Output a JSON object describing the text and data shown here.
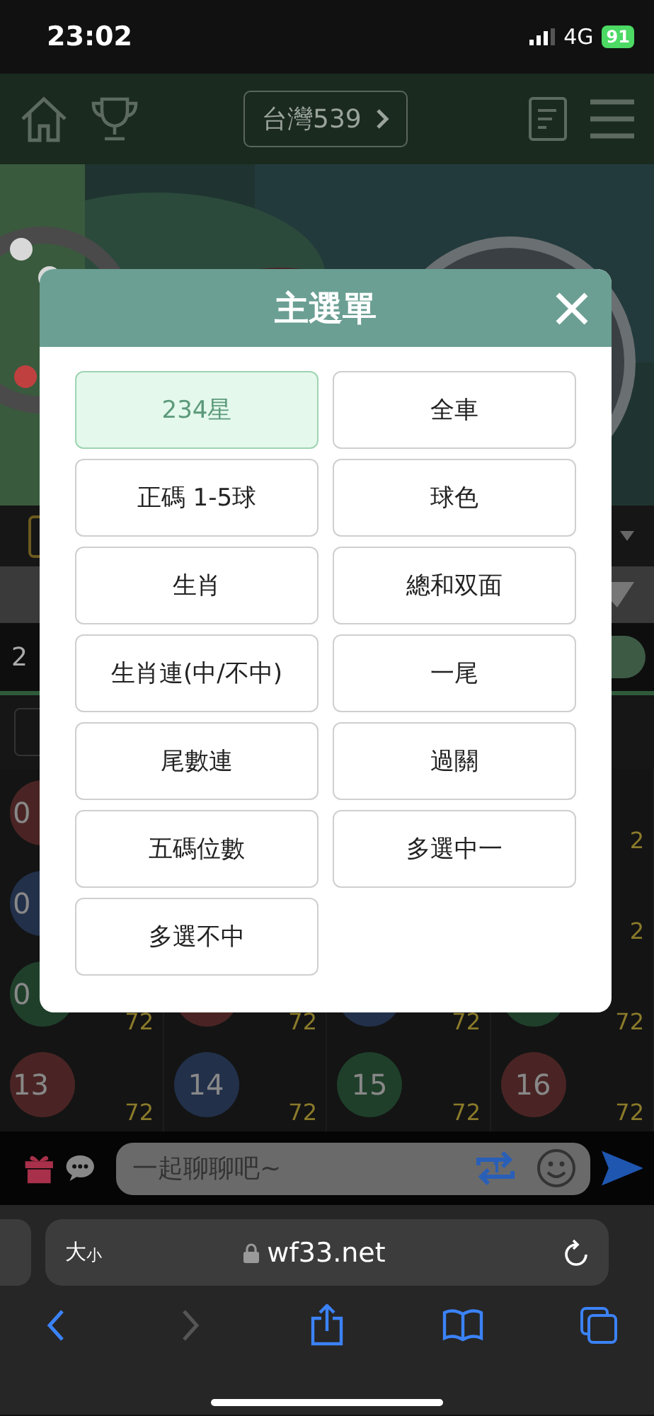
{
  "status_bar": {
    "time": "23:02",
    "network": "4G",
    "battery": "91"
  },
  "header": {
    "lottery_button": "台灣539"
  },
  "tab_row": {
    "label": "2"
  },
  "ball_grid": [
    [
      {
        "ball": "0",
        "color": "#4a2424"
      },
      {
        "odds": "2"
      }
    ],
    [
      {
        "ball": "0",
        "color": "#22304a"
      },
      {
        "odds": "2"
      }
    ],
    [
      {
        "ball": "0",
        "color": "#1f3f2a",
        "odds": "72"
      },
      {
        "color": "#4a2424",
        "odds": "72"
      },
      {
        "color": "#22304a",
        "odds": "72"
      },
      {
        "color": "#1f3f2a",
        "odds": "72"
      }
    ],
    [
      {
        "ball": "13",
        "color": "#4a2424",
        "odds": "72"
      },
      {
        "ball": "14",
        "color": "#22304a",
        "odds": "72"
      },
      {
        "ball": "15",
        "color": "#1f3f2a",
        "odds": "72"
      },
      {
        "ball": "16",
        "color": "#4a2424",
        "odds": "72"
      }
    ]
  ],
  "chat_bar": {
    "placeholder": "一起聊聊吧~"
  },
  "browser": {
    "text_size_button": "大小",
    "address": "wf33.net",
    "forward_disabled": true
  },
  "main_menu": {
    "title": "主選單",
    "items": [
      {
        "label": "234星",
        "selected": true
      },
      {
        "label": "全車",
        "selected": false
      },
      {
        "label": "正碼 1-5球",
        "selected": false
      },
      {
        "label": "球色",
        "selected": false
      },
      {
        "label": "生肖",
        "selected": false
      },
      {
        "label": "總和双面",
        "selected": false
      },
      {
        "label": "生肖連(中/不中)",
        "selected": false
      },
      {
        "label": "一尾",
        "selected": false
      },
      {
        "label": "尾數連",
        "selected": false
      },
      {
        "label": "過關",
        "selected": false
      },
      {
        "label": "五碼位數",
        "selected": false
      },
      {
        "label": "多選中一",
        "selected": false
      },
      {
        "label": "多選不中",
        "selected": false
      }
    ]
  }
}
